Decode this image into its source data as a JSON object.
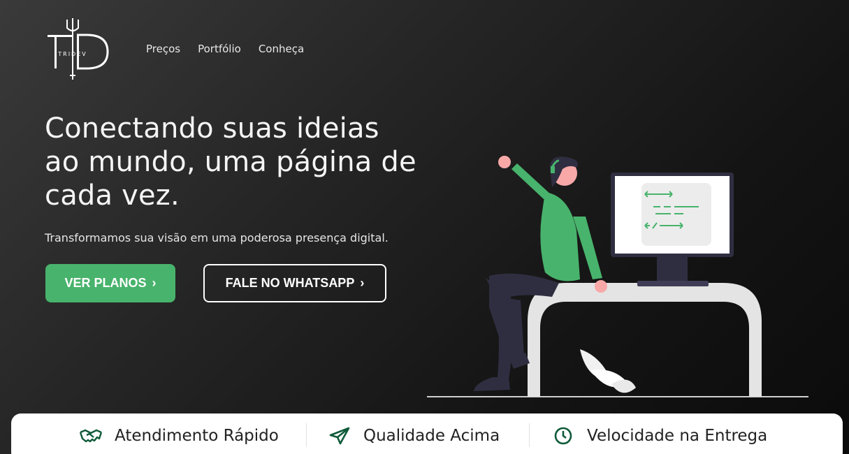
{
  "brand": {
    "logo_text": "TRIDEV",
    "logo_letters": "TD"
  },
  "nav": {
    "items": [
      "Preços",
      "Portfólio",
      "Conheça"
    ]
  },
  "hero": {
    "title": "Conectando suas ideias ao mundo, uma página de cada vez.",
    "subtitle": "Transformamos sua visão em uma poderosa presença digital.",
    "primary_button": "VER PLANOS",
    "secondary_button": "FALE NO WHATSAPP"
  },
  "features": [
    {
      "icon": "handshake-icon",
      "label": "Atendimento Rápido"
    },
    {
      "icon": "paper-plane-icon",
      "label": "Qualidade Acima"
    },
    {
      "icon": "clock-icon",
      "label": "Velocidade na Entrega"
    }
  ],
  "colors": {
    "accent": "#48b36c",
    "icon_dark_green": "#0f5a3a",
    "background_dark": "#1a1a1a"
  }
}
